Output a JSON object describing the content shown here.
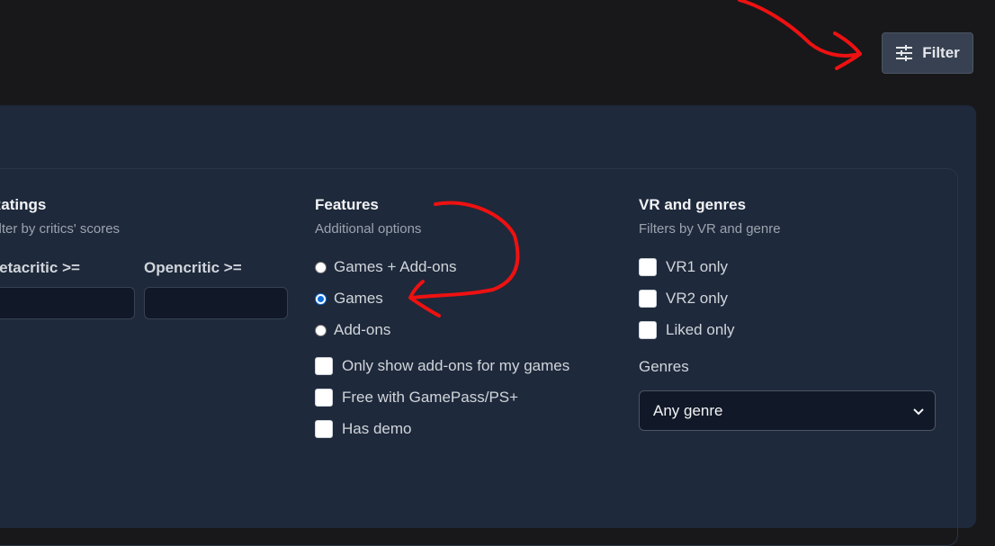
{
  "header": {
    "filter_button_label": "Filter",
    "filter_icon": "sliders-icon"
  },
  "ratings": {
    "title": "Ratings",
    "subtitle": "Filter by critics' scores",
    "metacritic_label": "Metacritic >=",
    "metacritic_value": "",
    "opencritic_label": "Opencritic >=",
    "opencritic_value": ""
  },
  "features": {
    "title": "Features",
    "subtitle": "Additional options",
    "radio_options": [
      {
        "label": "Games + Add-ons",
        "checked": false
      },
      {
        "label": "Games",
        "checked": true
      },
      {
        "label": "Add-ons",
        "checked": false
      }
    ],
    "checkbox_options": [
      {
        "label": "Only show add-ons for my games",
        "checked": false
      },
      {
        "label": "Free with GamePass/PS+",
        "checked": false
      },
      {
        "label": "Has demo",
        "checked": false
      }
    ]
  },
  "vr_genres": {
    "title": "VR and genres",
    "subtitle": "Filters by VR and genre",
    "checkbox_options": [
      {
        "label": "VR1 only",
        "checked": false
      },
      {
        "label": "VR2 only",
        "checked": false
      },
      {
        "label": "Liked only",
        "checked": false
      }
    ],
    "genres_label": "Genres",
    "genres_selected": "Any genre",
    "select_icon": "chevron-down-icon"
  },
  "colors": {
    "background": "#18181b",
    "panel": "#1e293b",
    "radio_accent": "#0b6bd6",
    "annotation": "#ee1111"
  }
}
